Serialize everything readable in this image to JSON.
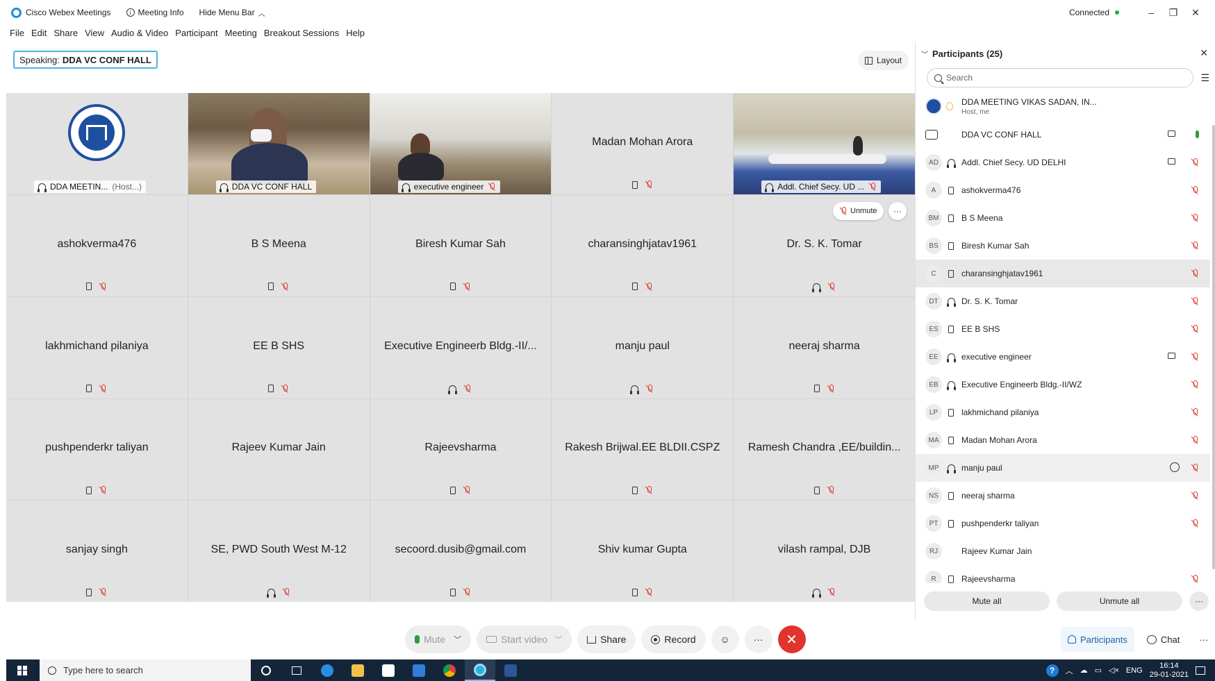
{
  "titlebar": {
    "app_name": "Cisco Webex Meetings",
    "meeting_info": "Meeting Info",
    "hide_menu": "Hide Menu Bar",
    "connection": "Connected",
    "minimize": "–",
    "restore": "❐",
    "close": "✕"
  },
  "menu": [
    "File",
    "Edit",
    "Share",
    "View",
    "Audio & Video",
    "Participant",
    "Meeting",
    "Breakout Sessions",
    "Help"
  ],
  "speaking": {
    "label": "Speaking:",
    "name": "DDA VC CONF HALL"
  },
  "layout_button": "Layout",
  "video_tiles": [
    {
      "label": "DDA MEETIN...",
      "suffix": "(Host...)"
    },
    {
      "label": "DDA VC CONF HALL"
    },
    {
      "label": "executive engineer"
    },
    {
      "name": "Madan Mohan Arora"
    },
    {
      "label": "Addl. Chief Secy. UD ..."
    }
  ],
  "name_tiles": [
    {
      "name": "ashokverma476",
      "device": "phone"
    },
    {
      "name": "B S Meena",
      "device": "phone"
    },
    {
      "name": "Biresh Kumar Sah",
      "device": "phone"
    },
    {
      "name": "charansinghjatav1961",
      "device": "phone"
    },
    {
      "name": "Dr. S. K. Tomar",
      "device": "headset"
    },
    {
      "name": "lakhmichand pilaniya",
      "device": "phone"
    },
    {
      "name": "EE B SHS",
      "device": "phone"
    },
    {
      "name": "Executive Engineerb Bldg.-II/...",
      "device": "headset"
    },
    {
      "name": "manju paul",
      "device": "headset"
    },
    {
      "name": "neeraj sharma",
      "device": "phone"
    },
    {
      "name": "pushpenderkr taliyan",
      "device": "phone"
    },
    {
      "name": "Rajeev Kumar Jain",
      "device": "none"
    },
    {
      "name": "Rajeevsharma",
      "device": "phone"
    },
    {
      "name": "Rakesh Brijwal.EE BLDII.CSPZ",
      "device": "phone"
    },
    {
      "name": "Ramesh Chandra ,EE/buildin...",
      "device": "phone"
    },
    {
      "name": "sanjay singh",
      "device": "phone"
    },
    {
      "name": "SE, PWD South West M-12",
      "device": "headset"
    },
    {
      "name": "secoord.dusib@gmail.com",
      "device": "phone"
    },
    {
      "name": "Shiv kumar Gupta",
      "device": "phone"
    },
    {
      "name": "vilash rampal, DJB",
      "device": "headset"
    }
  ],
  "tile_actions": {
    "unmute": "Unmute",
    "more": "···"
  },
  "controls": {
    "mute": "Mute",
    "start_video": "Start video",
    "share": "Share",
    "record": "Record",
    "reactions": "☺",
    "more": "···",
    "leave": "✕"
  },
  "panel": {
    "title": "Participants (25)",
    "close": "✕",
    "search_placeholder": "Search",
    "participants": [
      {
        "initials": "",
        "name": "DDA MEETING VIKAS SADAN, IN...",
        "sub": "Host, me",
        "device": "none"
      },
      {
        "initials": "",
        "name": "DDA VC CONF HALL",
        "device": "room",
        "video": true,
        "mic": "on"
      },
      {
        "initials": "AD",
        "name": "Addl. Chief Secy. UD DELHI",
        "device": "headset",
        "video": true,
        "mic": "muted"
      },
      {
        "initials": "A",
        "name": "ashokverma476",
        "device": "phone",
        "mic": "muted"
      },
      {
        "initials": "BM",
        "name": "B S Meena",
        "device": "phone",
        "mic": "muted"
      },
      {
        "initials": "BS",
        "name": "Biresh Kumar Sah",
        "device": "phone",
        "mic": "muted"
      },
      {
        "initials": "C",
        "name": "charansinghjatav1961",
        "device": "phone",
        "mic": "muted"
      },
      {
        "initials": "DT",
        "name": "Dr. S. K. Tomar",
        "device": "headset",
        "mic": "muted"
      },
      {
        "initials": "ES",
        "name": "EE B SHS",
        "device": "phone",
        "mic": "muted"
      },
      {
        "initials": "EE",
        "name": "executive engineer",
        "device": "headset",
        "video": true,
        "mic": "muted"
      },
      {
        "initials": "EB",
        "name": "Executive Engineerb Bldg.-II/WZ",
        "device": "headset",
        "mic": "muted"
      },
      {
        "initials": "LP",
        "name": "lakhmichand pilaniya",
        "device": "phone",
        "mic": "muted"
      },
      {
        "initials": "MA",
        "name": "Madan Mohan Arora",
        "device": "phone",
        "mic": "muted"
      },
      {
        "initials": "MP",
        "name": "manju paul",
        "device": "headset",
        "chat": true,
        "mic": "muted"
      },
      {
        "initials": "NS",
        "name": "neeraj sharma",
        "device": "phone",
        "mic": "muted"
      },
      {
        "initials": "PT",
        "name": "pushpenderkr taliyan",
        "device": "phone",
        "mic": "muted"
      },
      {
        "initials": "RJ",
        "name": "Rajeev Kumar Jain",
        "device": "none",
        "mic": "none"
      },
      {
        "initials": "R",
        "name": "Rajeevsharma",
        "device": "phone",
        "mic": "muted"
      }
    ],
    "mute_all": "Mute all",
    "unmute_all": "Unmute all",
    "more": "···"
  },
  "panel_tabs": {
    "participants": "Participants",
    "chat": "Chat",
    "more": "···"
  },
  "taskbar": {
    "search_placeholder": "Type here to search",
    "lang": "ENG",
    "time": "16:14",
    "date": "29-01-2021"
  },
  "colors": {
    "accent": "#28a7e9",
    "muted_red": "#d9372b",
    "leave_red": "#e3332d",
    "mic_green": "#2b9d3f",
    "taskbar": "#14253a"
  }
}
